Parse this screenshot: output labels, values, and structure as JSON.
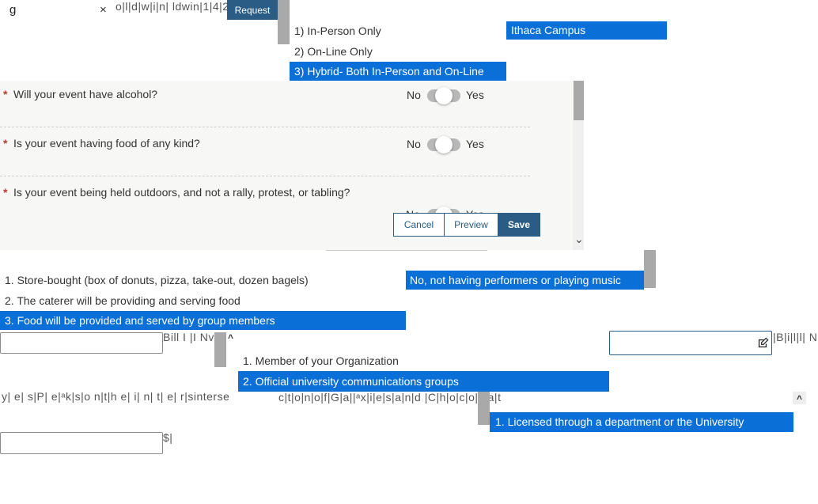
{
  "top": {
    "search_value": "g",
    "clear_symbol": "×",
    "garbled_text": "o|l|d|w|i|n| ldwin|1|4|2",
    "request_label": "Request"
  },
  "format_options": [
    {
      "label": "1) In-Person Only",
      "selected": false
    },
    {
      "label": "2) On-Line Only",
      "selected": false
    },
    {
      "label": "3) Hybrid- Both In-Person and On-Line",
      "selected": true
    }
  ],
  "campus_option": "Ithaca Campus",
  "questions": [
    {
      "text": "Will your event have alcohol?",
      "no": "No",
      "yes": "Yes"
    },
    {
      "text": "Is your event having food of any kind?",
      "no": "No",
      "yes": "Yes"
    },
    {
      "text": "Is your event being held outdoors, and not a rally, protest, or tabling?",
      "no": "No",
      "yes": "Yes"
    }
  ],
  "required_mark": "*",
  "actions": {
    "cancel": "Cancel",
    "preview": "Preview",
    "save": "Save"
  },
  "scroll_down_symbol": "⌄",
  "food_options": [
    {
      "label": "1. Store-bought (box of donuts, pizza, take-out, dozen bagels)",
      "selected": false
    },
    {
      "label": "2. The caterer will be providing and serving food",
      "selected": false
    },
    {
      "label": "3. Food will be provided and served by group members",
      "selected": true
    }
  ],
  "performers_option": "No, not having performers or playing music",
  "billing_text_left": "Bill I |I Nv",
  "billing_text_right": "|B|i|l|l|  N|",
  "caret_up": "^",
  "promotion_options": [
    {
      "label": "1. Member of your Organization",
      "selected": false
    },
    {
      "label": "2. Official university communications groups",
      "selected": true
    }
  ],
  "garbled_row": "y| e| s|P| e|ᵃk|s|o  n|t|h  e|  i|  n|  t|  e|  r|sinterse",
  "garbled_row2": "c|t|o|n|o|f|G|a||ᵃx|i|e|s|a|n|d  |C|h|o|c|o|l  |a|t",
  "license_option": "1. Licensed through a department or the University",
  "dollar_text": "$|",
  "colors": {
    "accent": "#0a6fd6",
    "button": "#2a5c86",
    "panel": "#f7f7f5"
  }
}
